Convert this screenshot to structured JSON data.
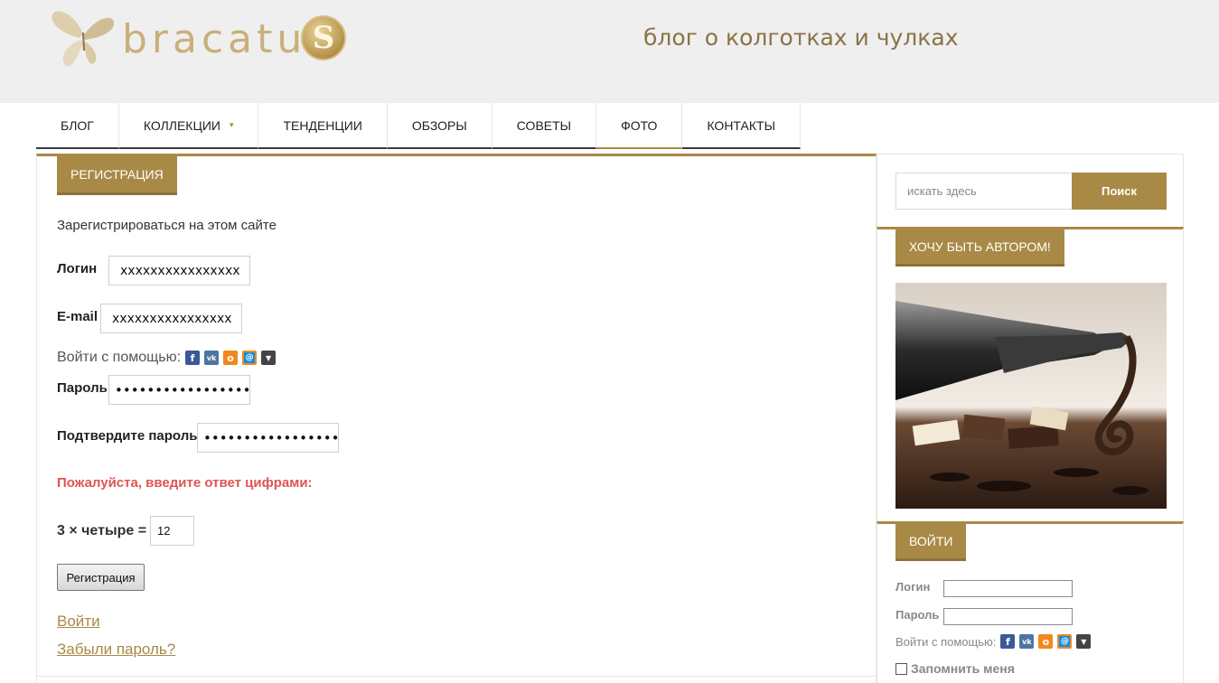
{
  "header": {
    "logo_text": "bracatu",
    "tagline": "блог о колготках и чулках"
  },
  "nav": {
    "items": [
      {
        "label": "БЛОГ"
      },
      {
        "label": "КОЛЛЕКЦИИ"
      },
      {
        "label": "ТЕНДЕНЦИИ"
      },
      {
        "label": "ОБЗОРЫ"
      },
      {
        "label": "СОВЕТЫ"
      },
      {
        "label": "ФОТО"
      },
      {
        "label": "КОНТАКТЫ"
      }
    ],
    "active": "ФОТО"
  },
  "registration": {
    "tab_label": "РЕГИСТРАЦИЯ",
    "intro": "Зарегистрироваться на этом сайте",
    "login_label": "Логин",
    "login_value": "xxxxxxxxxxxxxxxx",
    "email_label": "E-mail",
    "email_value": "xxxxxxxxxxxxxxxx",
    "social_label": "Войти с помощью:",
    "password_label": "Пароль",
    "password_value": "••••••••••••••••••",
    "confirm_label": "Подтвердите пароль",
    "confirm_value": "••••••••••••••••••",
    "captcha_warning": "Пожалуйста, введите ответ цифрами:",
    "captcha_question": "3 × четыре =",
    "captcha_answer": "12",
    "submit_label": "Регистрация",
    "login_link": "Войти",
    "forgot_link": "Забыли пароль?"
  },
  "sidebar": {
    "search_placeholder": "искать здесь",
    "search_button": "Поиск",
    "author_tab": "ХОЧУ БЫТЬ АВТОРОМ!",
    "login_tab": "ВОЙТИ",
    "login_label": "Логин",
    "password_label": "Пароль",
    "social_label": "Войти с помощью:",
    "remember_label": "Запомнить меня"
  },
  "colors": {
    "accent": "#a88a46",
    "warning": "#e05454",
    "header_bg": "#efefef"
  },
  "icons": {
    "social": [
      "facebook-icon",
      "vk-icon",
      "odnoklassniki-icon",
      "mailru-icon",
      "more-dropdown-icon"
    ]
  }
}
